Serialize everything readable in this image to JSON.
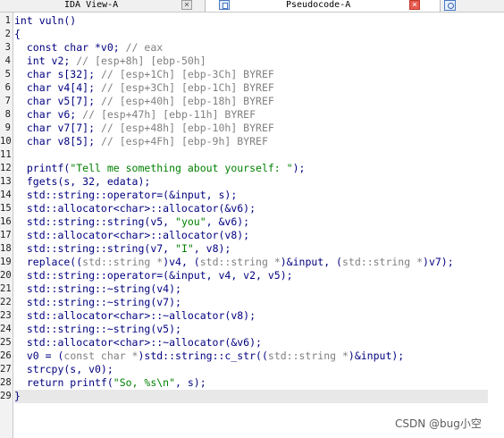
{
  "tabs": [
    {
      "label": "IDA View-A",
      "close": "×"
    },
    {
      "label": "Pseudocode-A",
      "close": "×"
    }
  ],
  "code_lines": [
    "int vuln()",
    "{",
    "  const char *v0; // eax",
    "  int v2; // [esp+8h] [ebp-50h]",
    "  char s[32]; // [esp+1Ch] [ebp-3Ch] BYREF",
    "  char v4[4]; // [esp+3Ch] [ebp-1Ch] BYREF",
    "  char v5[7]; // [esp+40h] [ebp-18h] BYREF",
    "  char v6; // [esp+47h] [ebp-11h] BYREF",
    "  char v7[7]; // [esp+48h] [ebp-10h] BYREF",
    "  char v8[5]; // [esp+4Fh] [ebp-9h] BYREF",
    "",
    "  printf(\"Tell me something about yourself: \");",
    "  fgets(s, 32, edata);",
    "  std::string::operator=(&input, s);",
    "  std::allocator<char>::allocator(&v6);",
    "  std::string::string(v5, \"you\", &v6);",
    "  std::allocator<char>::allocator(v8);",
    "  std::string::string(v7, \"I\", v8);",
    "  replace((std::string *)v4, (std::string *)&input, (std::string *)v7);",
    "  std::string::operator=(&input, v4, v2, v5);",
    "  std::string::~string(v4);",
    "  std::string::~string(v7);",
    "  std::allocator<char>::~allocator(v8);",
    "  std::string::~string(v5);",
    "  std::allocator<char>::~allocator(&v6);",
    "  v0 = (const char *)std::string::c_str((std::string *)&input);",
    "  strcpy(s, v0);",
    "  return printf(\"So, %s\\n\", s);",
    "}"
  ],
  "line_numbers": [
    "1",
    "2",
    "3",
    "4",
    "5",
    "6",
    "7",
    "8",
    "9",
    "10",
    "11",
    "12",
    "13",
    "14",
    "15",
    "16",
    "17",
    "18",
    "19",
    "20",
    "21",
    "22",
    "23",
    "24",
    "25",
    "26",
    "27",
    "28",
    "29"
  ],
  "current_line": 29,
  "watermark": "CSDN @bug小空",
  "colors": {
    "code": "#000080",
    "comment": "#808080",
    "string": "#008000",
    "current_line_bg": "#e8e8e8",
    "close_active": "#e85a4f"
  },
  "icons": [
    "close-icon",
    "pseudocode-tab-icon",
    "hex-view-icon"
  ]
}
